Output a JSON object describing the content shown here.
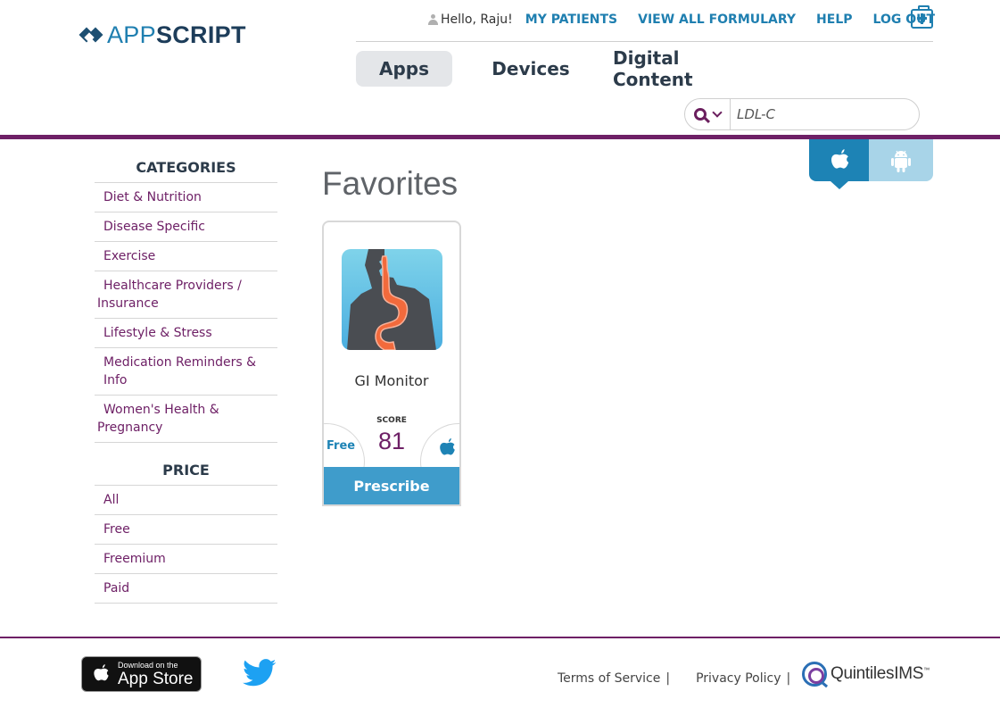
{
  "brand": {
    "logo_light": "APP",
    "logo_bold": "SCRIPT"
  },
  "topnav": {
    "greeting": "Hello, Raju!",
    "links": [
      "MY PATIENTS",
      "VIEW ALL FORMULARY",
      "HELP",
      "LOG OUT"
    ]
  },
  "main_tabs": [
    "Apps",
    "Devices",
    "Digital Content"
  ],
  "search": {
    "value": "LDL-C"
  },
  "sidebar": {
    "categories_title": "CATEGORIES",
    "categories": [
      "Diet & Nutrition",
      "Disease Specific",
      "Exercise",
      "Healthcare Providers / Insurance",
      "Lifestyle & Stress",
      "Medication Reminders & Info",
      "Women's Health & Pregnancy"
    ],
    "price_title": "PRICE",
    "prices": [
      "All",
      "Free",
      "Freemium",
      "Paid"
    ]
  },
  "main": {
    "title": "Favorites",
    "card": {
      "name": "GI Monitor",
      "score_label": "SCORE",
      "score": "81",
      "price": "Free",
      "button": "Prescribe"
    }
  },
  "footer": {
    "appstore_small": "Download on the",
    "appstore_big": "App Store",
    "terms": "Terms of Service",
    "privacy": "Privacy Policy",
    "sep": "|",
    "partner": "QuintilesIMS",
    "partner_tm": "™"
  },
  "colors": {
    "brand_purple": "#6e2066",
    "brand_blue": "#1f7fb0",
    "ios_active": "#1d83b5",
    "android_inactive": "#a8d4e8",
    "prescribe_bg": "#3f9ccb"
  },
  "icons": [
    "logo-diamond-icon",
    "user-icon",
    "medical-kit-icon",
    "search-icon",
    "chevron-down-icon",
    "apple-icon",
    "android-icon",
    "twitter-icon",
    "quintiles-logo-icon"
  ]
}
